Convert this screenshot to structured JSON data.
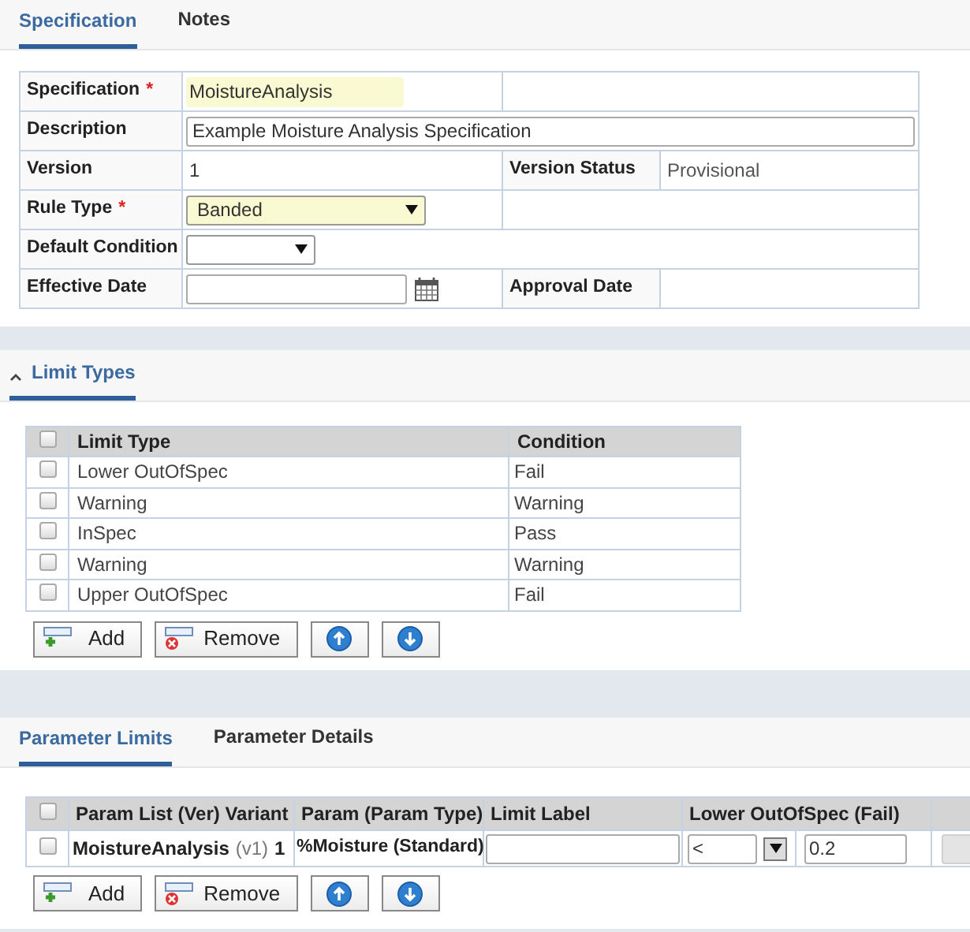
{
  "tabs": [
    {
      "label": "Specification",
      "selected": true
    },
    {
      "label": "Notes",
      "selected": false
    }
  ],
  "form": [
    {
      "label": "Specification",
      "required": true,
      "required_mark": "*",
      "kind": "text",
      "value": "MoistureAnalysis",
      "span": false
    },
    {
      "label": "Description",
      "required": false,
      "kind": "wide",
      "value": "Example Moisture Analysis Specification",
      "span": true
    },
    {
      "label": "Version",
      "required": false,
      "kind": "plain",
      "value": "1",
      "span": false,
      "side_label": "Version Status",
      "side_value": "Provisional"
    },
    {
      "label": "Rule Type",
      "required": true,
      "required_mark": "*",
      "kind": "select",
      "value": "Banded",
      "span": false
    },
    {
      "label": "Default Condition",
      "required": false,
      "kind": "select",
      "span": true
    },
    {
      "label": "Effective Date",
      "required": false,
      "kind": "date",
      "span": false,
      "side_label": "Approval Date"
    }
  ],
  "limit_types": {
    "title": "Limit Types",
    "expanded": true,
    "select_all_checked": false,
    "columns": [
      "Limit Type",
      "Condition"
    ],
    "rows": [
      {
        "checked": false,
        "limit_type": "Lower OutOfSpec",
        "condition": "Fail"
      },
      {
        "checked": false,
        "limit_type": "Warning",
        "condition": "Warning"
      },
      {
        "checked": false,
        "limit_type": "InSpec",
        "condition": "Pass"
      },
      {
        "checked": false,
        "limit_type": "Warning",
        "condition": "Warning"
      },
      {
        "checked": false,
        "limit_type": "Upper OutOfSpec",
        "condition": "Fail"
      }
    ],
    "buttons": [
      {
        "kind": "add",
        "label": "Add"
      },
      {
        "kind": "remove",
        "label": "Remove"
      },
      {
        "kind": "up"
      },
      {
        "kind": "down"
      }
    ]
  },
  "parameter_tabs": [
    {
      "label": "Parameter Limits",
      "selected": true
    },
    {
      "label": "Parameter Details",
      "selected": false
    }
  ],
  "parameter_limits": {
    "select_all_checked": false,
    "columns": [
      "Param List (Ver) Variant",
      "Param (Param Type)",
      "Limit Label",
      "Lower OutOfSpec (Fail)"
    ],
    "rows": [
      {
        "checked": false,
        "param_list": "MoistureAnalysis",
        "version": "(v1)",
        "variant": "1",
        "param": "%Moisture (Standard)",
        "operator": "<",
        "value": "0.2",
        "column_6": {
          "disabled": true
        }
      }
    ],
    "buttons": [
      {
        "kind": "add",
        "label": "Add"
      },
      {
        "kind": "remove",
        "label": "Remove"
      },
      {
        "kind": "up"
      },
      {
        "kind": "down"
      }
    ]
  }
}
